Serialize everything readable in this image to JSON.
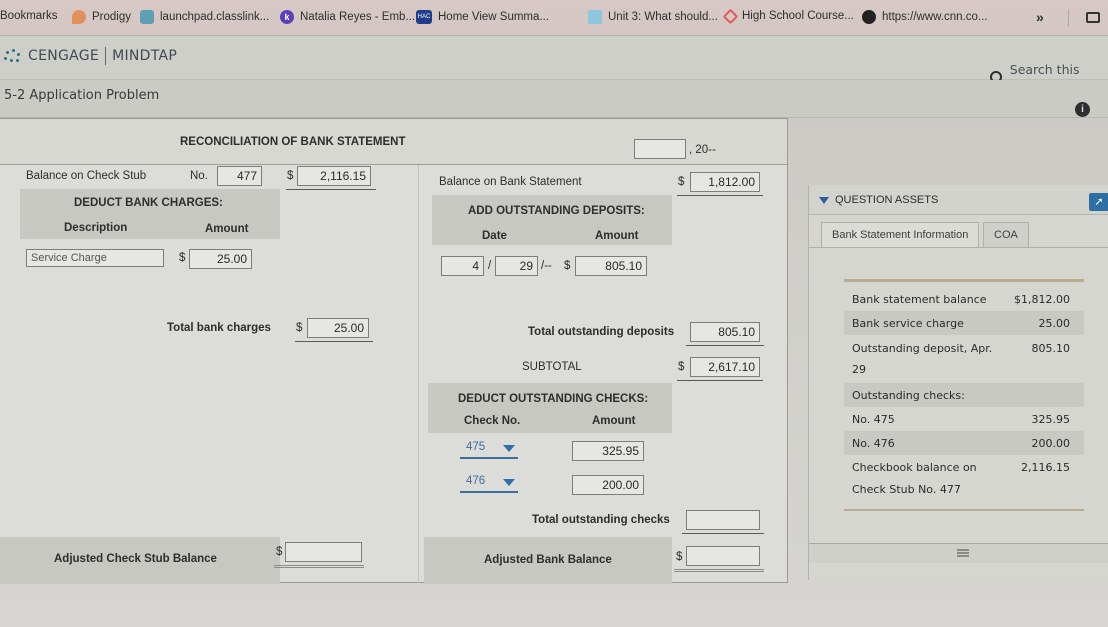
{
  "browser": {
    "bookmarks": [
      {
        "label": "Bookmarks",
        "icon": "none"
      },
      {
        "label": "Prodigy",
        "icon": "prodigy-icon"
      },
      {
        "label": "launchpad.classlink...",
        "icon": "classlink-icon"
      },
      {
        "label": "Natalia Reyes - Emb...",
        "icon": "k-icon"
      },
      {
        "label": "Home View Summa...",
        "icon": "hac-icon"
      },
      {
        "label": "Unit 3: What should...",
        "icon": "p-icon"
      },
      {
        "label": "High School Course...",
        "icon": "hs-icon"
      },
      {
        "label": "https://www.cnn.co...",
        "icon": "globe-icon"
      }
    ],
    "overflow_label": "»"
  },
  "app": {
    "brand": "CENGAGE",
    "product": "MINDTAP",
    "search_placeholder": "Search this cour",
    "problem_title": "5-2 Application Problem",
    "info_glyph": "i"
  },
  "form": {
    "title": "RECONCILIATION OF BANK STATEMENT",
    "date_value": "",
    "year_suffix": ", 20--",
    "left": {
      "check_stub_label": "Balance on Check Stub",
      "no_label": "No.",
      "check_stub_no": "477",
      "check_stub_balance": "2,116.15",
      "deduct_header": "DEDUCT BANK CHARGES:",
      "col_description": "Description",
      "col_amount": "Amount",
      "charges": [
        {
          "description": "Service Charge",
          "amount": "25.00"
        }
      ],
      "total_charges_label": "Total bank charges",
      "total_charges_value": "25.00",
      "adjusted_label": "Adjusted Check Stub Balance",
      "adjusted_value": ""
    },
    "right": {
      "bank_balance_label": "Balance on Bank Statement",
      "bank_balance_value": "1,812.00",
      "add_header": "ADD OUTSTANDING DEPOSITS:",
      "col_date": "Date",
      "col_amount": "Amount",
      "deposits": [
        {
          "month": "4",
          "day": "29",
          "year_suffix": "/--",
          "amount": "805.10"
        }
      ],
      "total_deposits_label": "Total outstanding deposits",
      "total_deposits_value": "805.10",
      "subtotal_label": "SUBTOTAL",
      "subtotal_value": "2,617.10",
      "deduct_header": "DEDUCT OUTSTANDING CHECKS:",
      "col_check_no": "Check No.",
      "col_check_amount": "Amount",
      "checks": [
        {
          "number": "475",
          "amount": "325.95"
        },
        {
          "number": "476",
          "amount": "200.00"
        }
      ],
      "total_checks_label": "Total outstanding checks",
      "total_checks_value": "",
      "adjusted_label": "Adjusted Bank Balance",
      "adjusted_value": ""
    },
    "currency": "$",
    "date_sep": "/"
  },
  "assets": {
    "title": "QUESTION ASSETS",
    "tabs": [
      {
        "label": "Bank Statement Information",
        "active": true
      },
      {
        "label": "COA",
        "active": false
      }
    ],
    "rows": [
      {
        "key": "Bank statement balance",
        "value": "$1,812.00"
      },
      {
        "key": "Bank service charge",
        "value": "25.00"
      },
      {
        "key": "Outstanding deposit, Apr.",
        "value": "805.10"
      },
      {
        "key": "29",
        "value": ""
      },
      {
        "key": "Outstanding checks:",
        "value": ""
      },
      {
        "key": "No. 475",
        "value": "325.95"
      },
      {
        "key": "No. 476",
        "value": "200.00"
      },
      {
        "key": "Checkbook balance on",
        "value": "2,116.15"
      },
      {
        "key": "Check Stub No. 477",
        "value": ""
      }
    ]
  }
}
